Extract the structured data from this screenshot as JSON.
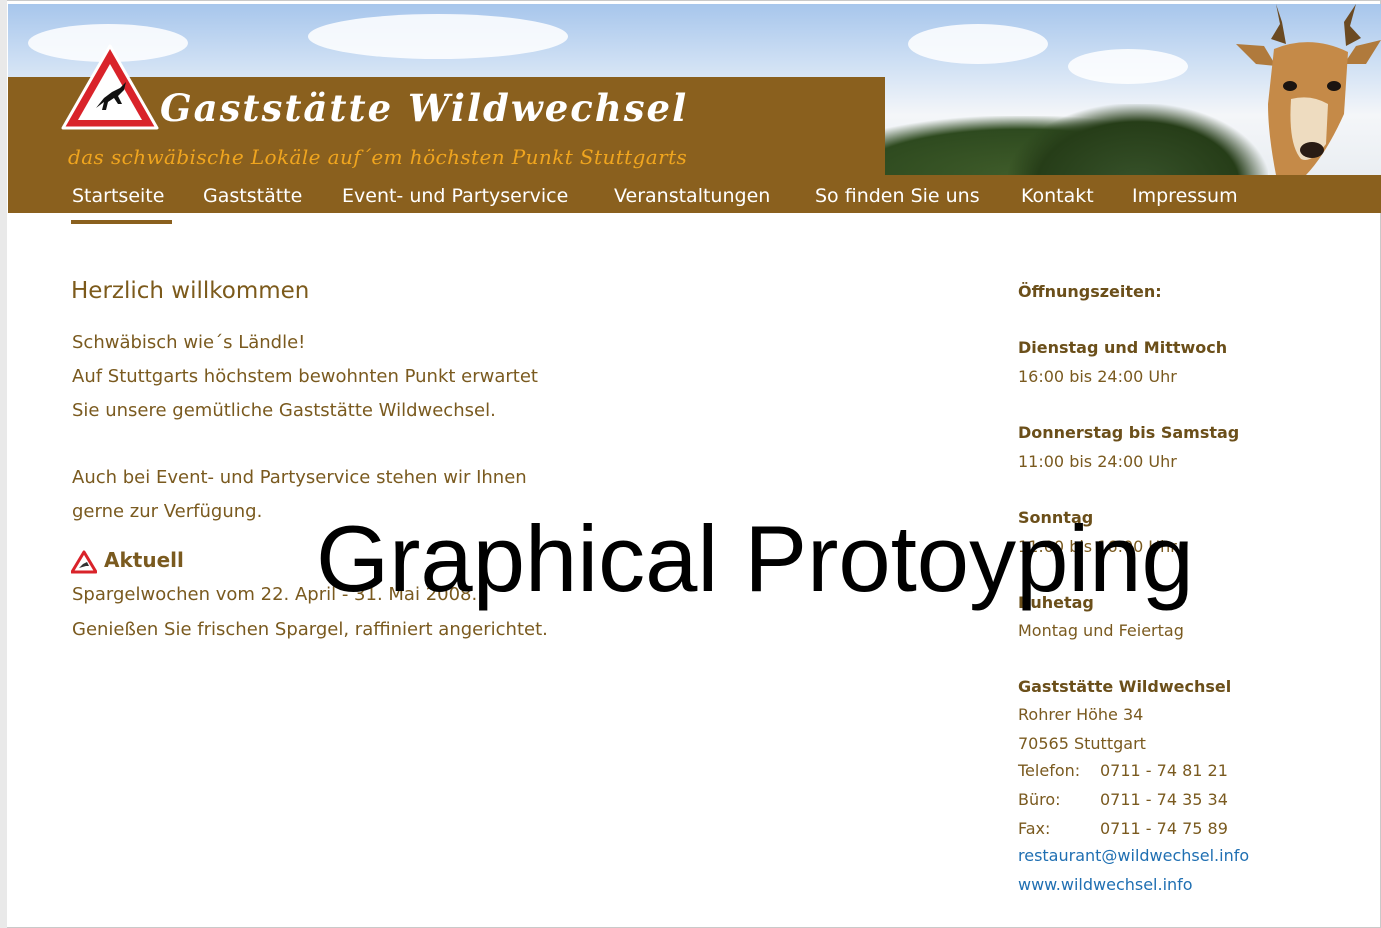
{
  "header": {
    "title": "Gaststätte Wildwechsel",
    "slogan": "das schwäbische Lokäle auf´em höchsten Punkt Stuttgarts"
  },
  "nav": {
    "items": [
      {
        "label": "Startseite"
      },
      {
        "label": "Gaststätte"
      },
      {
        "label": "Event- und Partyservice"
      },
      {
        "label": "Veranstaltungen"
      },
      {
        "label": "So finden Sie uns"
      },
      {
        "label": "Kontakt"
      },
      {
        "label": "Impressum"
      }
    ],
    "active": "Startseite"
  },
  "main": {
    "heading": "Herzlich willkommen",
    "intro": [
      "Schwäbisch wie´s Ländle!",
      "Auf Stuttgarts höchstem bewohnten Punkt erwartet",
      "Sie unsere gemütliche Gaststätte Wildwechsel."
    ],
    "service": [
      "Auch bei Event- und Partyservice stehen wir Ihnen",
      "gerne zur Verfügung."
    ],
    "aktuell": {
      "label": "Aktuell",
      "lines": [
        "Spargelwochen vom 22. April - 31. Mai 2008.",
        "Genießen Sie frischen Spargel, raffiniert angerichtet."
      ]
    }
  },
  "sidebar": {
    "heading": "Öffnungszeiten:",
    "hours": [
      {
        "days": "Dienstag und Mittwoch",
        "time": "16:00 bis 24:00 Uhr"
      },
      {
        "days": "Donnerstag bis Samstag",
        "time": "11:00 bis 24:00 Uhr"
      },
      {
        "days": "Sonntag",
        "time": "11:00 bis 16:00 Uhr"
      },
      {
        "days": "Ruhetag",
        "time": "Montag und Feiertag"
      }
    ],
    "address": {
      "name": "Gaststätte Wildwechsel",
      "street": "Rohrer Höhe 34",
      "city": "70565 Stuttgart",
      "phones": [
        {
          "label": "Telefon:",
          "number": "0711 - 74 81 21"
        },
        {
          "label": "Büro:",
          "number": "0711 - 74 35 34"
        },
        {
          "label": "Fax:",
          "number": "0711 - 74 75 89"
        }
      ],
      "email": "restaurant@wildwechsel.info",
      "web": "www.wildwechsel.info"
    }
  },
  "overlay": {
    "text": "Graphical Protoyping"
  },
  "colors": {
    "brand_brown": "#8a601e",
    "text_brown": "#7a5a1f",
    "slogan_orange": "#f0a51e",
    "link_blue": "#1f6fb2",
    "sign_red": "#d9232a"
  }
}
